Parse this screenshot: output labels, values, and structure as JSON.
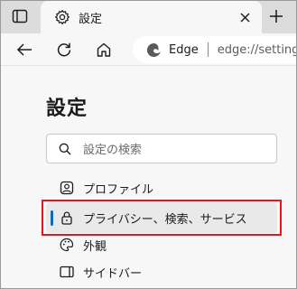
{
  "browser": {
    "tab": {
      "title": "設定"
    },
    "omnibox": {
      "site_name": "Edge",
      "url": "edge://settings"
    }
  },
  "page": {
    "title": "設定",
    "search": {
      "placeholder": "設定の検索"
    },
    "nav_items": [
      {
        "label": "プロファイル",
        "icon": "profile-icon"
      },
      {
        "label": "プライバシー、検索、サービス",
        "icon": "lock-icon",
        "active": true
      },
      {
        "label": "外観",
        "icon": "palette-icon"
      },
      {
        "label": "サイドバー",
        "icon": "sidebar-icon"
      }
    ]
  },
  "colors": {
    "accent": "#0f6cbd",
    "highlight_border": "#e3161c"
  }
}
